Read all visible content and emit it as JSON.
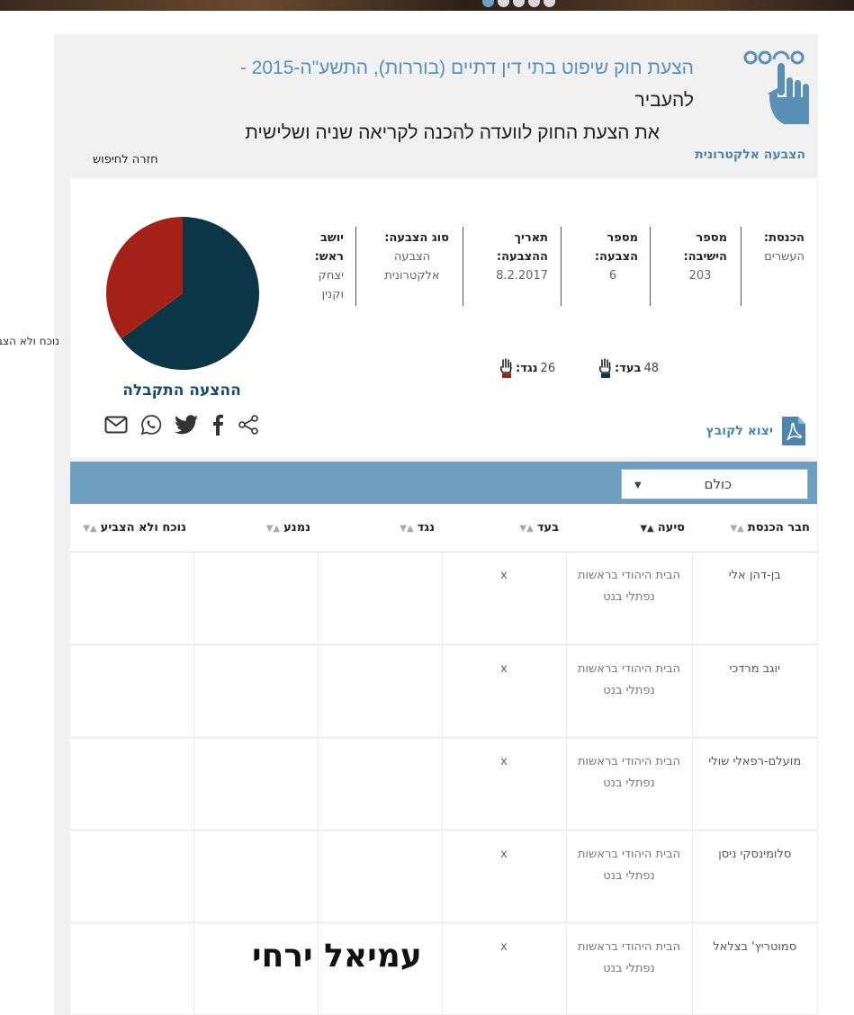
{
  "header": {
    "title_blue": "הצעת חוק שיפוט בתי דין דתיים (בוררות), התשע\"ה-2015 -",
    "title_dark1": "להעביר",
    "title_dark2": "את הצעת החוק לוועדה להכנה לקריאה שניה ושלישית"
  },
  "nav": {
    "electronic_vote": "הצבעה אלקטרונית",
    "back_to_search": "חזרה לחיפוש"
  },
  "left_overflow_text": "נוכח ולא הצביע",
  "info": {
    "knesset_label": "הכנסת:",
    "knesset_value": "העשרים",
    "session_label": "מספר הישיבה:",
    "session_value": "203",
    "vote_no_label": "מספר הצבעה:",
    "vote_no_value": "6",
    "date_label": "תאריך ההצבעה:",
    "date_value": "8.2.2017",
    "type_label": "סוג הצבעה:",
    "type_value": "הצבעה אלקטרונית",
    "chair_label": "יושב ראש:",
    "chair_value": "יצחק וקנין"
  },
  "tally": {
    "for_label": "בעד:",
    "for_value": "48",
    "against_label": "נגד:",
    "against_value": "26"
  },
  "result_caption": "ההצעה התקבלה",
  "file_link": "יצוא לקובץ",
  "share_icons": [
    "share-icon",
    "facebook-icon",
    "twitter-icon",
    "whatsapp-icon",
    "email-icon"
  ],
  "colors": {
    "for": "#0c3645",
    "against": "#a32116",
    "accent": "#6e9fc0"
  },
  "chart_data": {
    "type": "pie",
    "labels": [
      "בעד",
      "נגד"
    ],
    "values": [
      48,
      26
    ]
  },
  "filter": {
    "selected": "כולם"
  },
  "table": {
    "headers": [
      "חבר הכנסת",
      "סיעה",
      "בעד",
      "נגד",
      "נמנע",
      "נוכח ולא הצביע"
    ],
    "rows": [
      {
        "name": "בן-דהן אלי",
        "faction": "הבית היהודי בראשות נפתלי בנט",
        "for": "x",
        "against": "",
        "abstain": "",
        "present": ""
      },
      {
        "name": "יוגב מרדכי",
        "faction": "הבית היהודי בראשות נפתלי בנט",
        "for": "x",
        "against": "",
        "abstain": "",
        "present": ""
      },
      {
        "name": "מועלם-רפאלי שולי",
        "faction": "הבית היהודי בראשות נפתלי בנט",
        "for": "x",
        "against": "",
        "abstain": "",
        "present": ""
      },
      {
        "name": "סלומינסקי ניסן",
        "faction": "הבית היהודי בראשות נפתלי בנט",
        "for": "x",
        "against": "",
        "abstain": "",
        "present": ""
      },
      {
        "name": "סמוטריץ' בצלאל",
        "faction": "הבית היהודי בראשות נפתלי בנט",
        "for": "x",
        "against": "",
        "abstain": "",
        "present": ""
      }
    ]
  },
  "watermark": "עמיאל ירחי"
}
